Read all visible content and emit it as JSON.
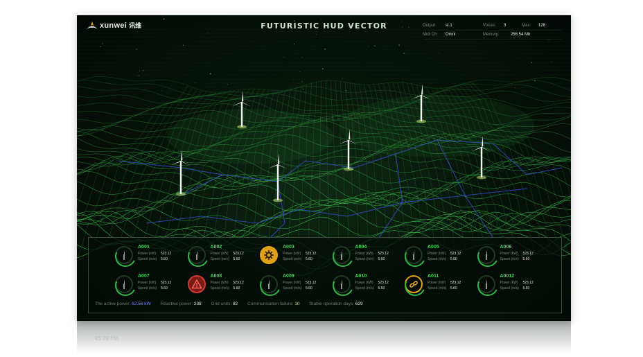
{
  "header": {
    "brand": "xunwei",
    "brand_cn": "讯维",
    "title": "FUTURISTIC HUD VECTOR",
    "stats": [
      {
        "key": "Output:",
        "value": "st.1",
        "key2": "Voices:",
        "value2": "3",
        "key3": "Max:",
        "value3": "128"
      },
      {
        "key": "Midi Ch:",
        "value": "Omni",
        "key2": "Memory:",
        "value2": "256.54 Mb"
      }
    ]
  },
  "turbines": [
    {
      "id": "A001",
      "status": "normal",
      "power_label": "Power (kW)",
      "power": "523.12",
      "speed_label": "Speed (m/s)",
      "speed": "5.60"
    },
    {
      "id": "A002",
      "status": "normal",
      "power_label": "Power (kW)",
      "power": "523.12",
      "speed_label": "Speed (m/s)",
      "speed": "5.60"
    },
    {
      "id": "A003",
      "status": "fault",
      "power_label": "Power (kW)",
      "power": "523.12",
      "speed_label": "Speed (m/s)",
      "speed": "5.60"
    },
    {
      "id": "A004",
      "status": "normal",
      "power_label": "Power (kW)",
      "power": "523.12",
      "speed_label": "Speed (m/s)",
      "speed": "5.60"
    },
    {
      "id": "A005",
      "status": "normal",
      "power_label": "Power (kW)",
      "power": "523.12",
      "speed_label": "Speed (m/s)",
      "speed": "5.60"
    },
    {
      "id": "A006",
      "status": "normal",
      "power_label": "Power (kW)",
      "power": "523.12",
      "speed_label": "Speed (m/s)",
      "speed": "5.60"
    },
    {
      "id": "A007",
      "status": "normal",
      "power_label": "Power (kW)",
      "power": "523.12",
      "speed_label": "Speed (m/s)",
      "speed": "5.60"
    },
    {
      "id": "A008",
      "status": "warning",
      "power_label": "Power (kW)",
      "power": "523.12",
      "speed_label": "Speed (m/s)",
      "speed": "5.60"
    },
    {
      "id": "A009",
      "status": "normal",
      "power_label": "Power (kW)",
      "power": "523.12",
      "speed_label": "Speed (m/s)",
      "speed": "5.60"
    },
    {
      "id": "A010",
      "status": "normal",
      "power_label": "Power (kW)",
      "power": "523.12",
      "speed_label": "Speed (m/s)",
      "speed": "5.60"
    },
    {
      "id": "A011",
      "status": "link",
      "power_label": "Power (kW)",
      "power": "523.12",
      "speed_label": "Speed (m/s)",
      "speed": "5.60"
    },
    {
      "id": "A0012",
      "status": "normal",
      "power_label": "Power (kW)",
      "power": "523.12",
      "speed_label": "Speed (m/s)",
      "speed": "5.60"
    }
  ],
  "summary": {
    "active_power_label": "The active power:",
    "active_power": "62.56 kW",
    "reactive_power_label": "Reactive power:",
    "reactive_power": "238",
    "grid_units_label": "Grid units:",
    "grid_units": "82",
    "comm_failure_label": "Communication failure:",
    "comm_failure": "10",
    "stable_days_label": "Stable operation days:",
    "stable_days": "629"
  },
  "colors": {
    "accent_green": "#3fd85a",
    "fault_amber": "#e0a317",
    "warning_red": "#d23a33",
    "power_blue": "#7a8bff"
  },
  "icons": {
    "normal": "wind-turbine-icon",
    "fault": "gear-fault-icon",
    "warning": "warning-triangle-icon",
    "link": "broken-link-icon"
  }
}
